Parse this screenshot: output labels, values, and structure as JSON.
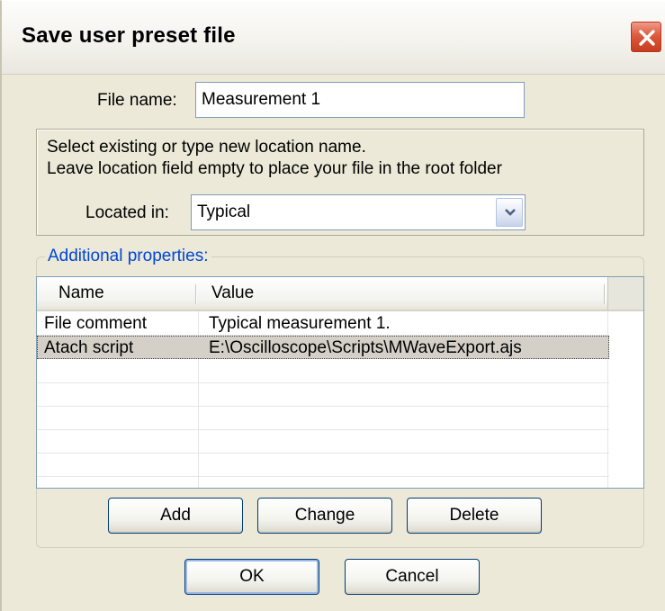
{
  "window": {
    "title": "Save user preset file",
    "close_icon": "close-x-icon"
  },
  "file_name": {
    "label": "File name:",
    "value": "Measurement 1"
  },
  "location": {
    "instruction_line1": "Select existing or type new location name.",
    "instruction_line2": "Leave location field empty to place your file in the root folder",
    "label": "Located in:",
    "value": "Typical",
    "dropdown_icon": "chevron-down-icon"
  },
  "properties": {
    "group_label": "Additional properties:",
    "columns": [
      "Name",
      "Value"
    ],
    "rows": [
      {
        "name": "File comment",
        "value": "Typical measurement 1."
      },
      {
        "name": "Atach script",
        "value": "E:\\Oscilloscope\\Scripts\\MWaveExport.ajs"
      }
    ],
    "selected_row": 1,
    "add_label": "Add",
    "change_label": "Change",
    "delete_label": "Delete"
  },
  "footer": {
    "ok_label": "OK",
    "cancel_label": "Cancel"
  },
  "colors": {
    "dialog_bg": "#ece9d8",
    "group_label": "#0046d5",
    "close_button": "#dd5a3c",
    "selection": "#d4d0c8"
  }
}
